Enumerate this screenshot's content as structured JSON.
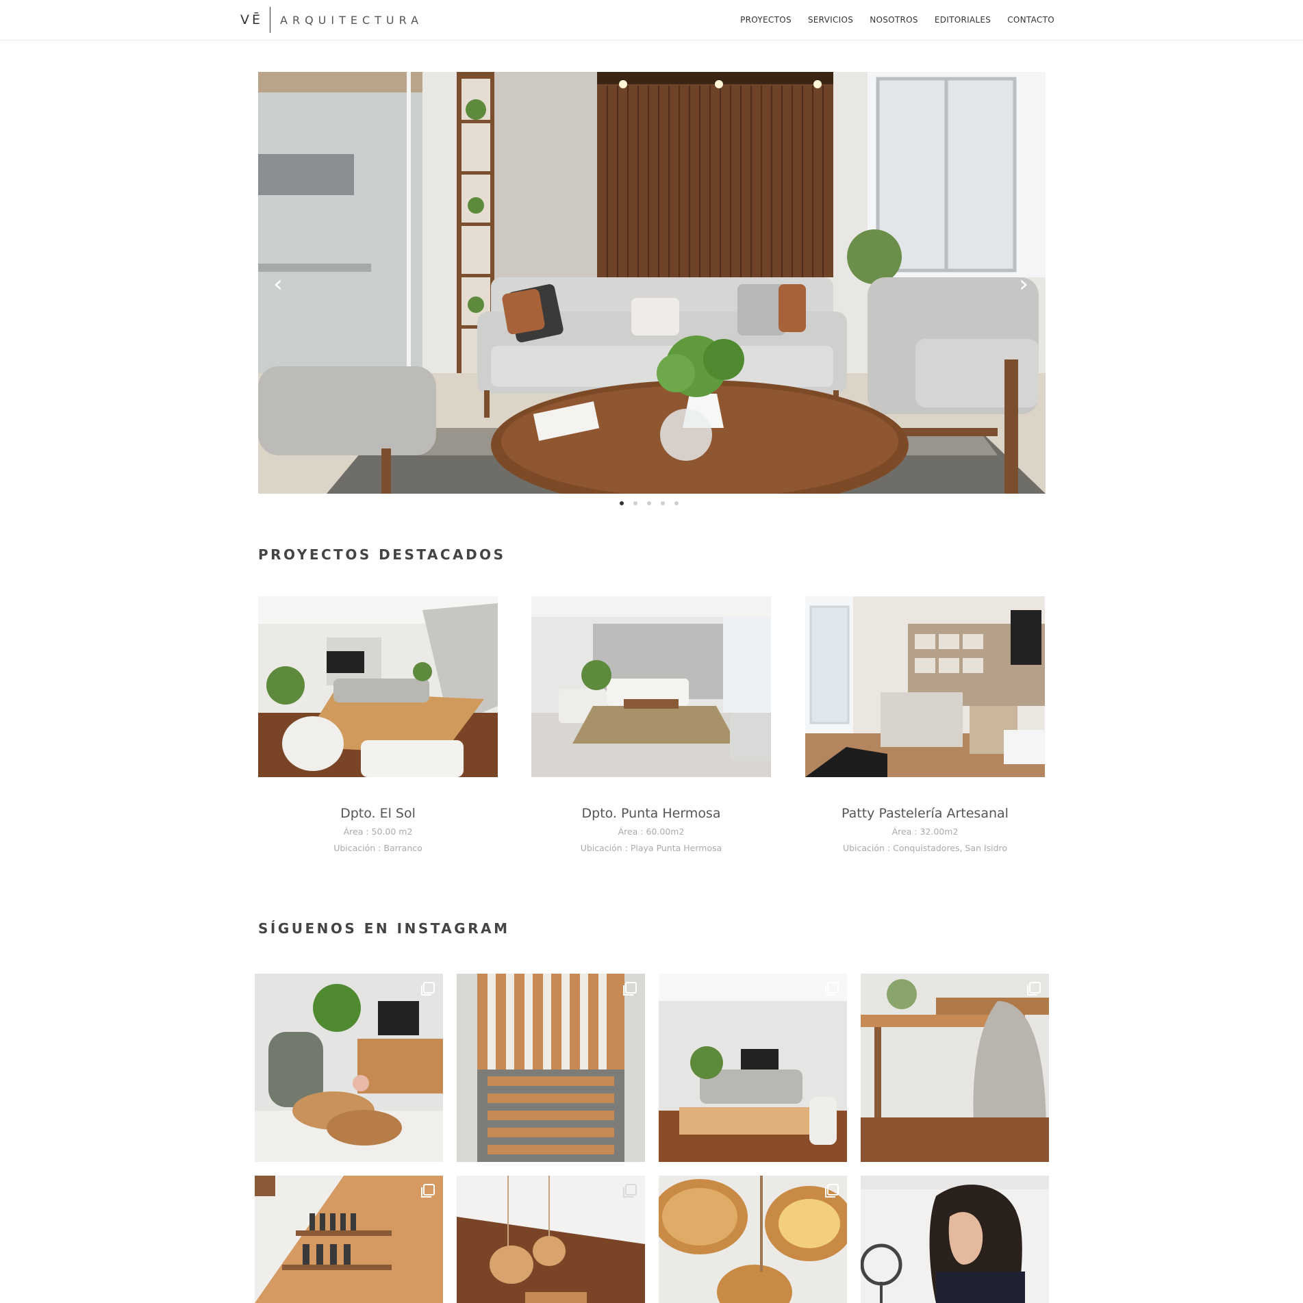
{
  "header": {
    "logo_mark": "VĒ",
    "logo_name": "ARQUITECTURA",
    "nav": [
      "PROYECTOS",
      "SERVICIOS",
      "NOSOTROS",
      "EDITORIALES",
      "CONTACTO"
    ]
  },
  "hero": {
    "prev_icon": "chevron-left-icon",
    "next_icon": "chevron-right-icon",
    "prev_glyph": "‹",
    "next_glyph": "›",
    "slide_count": 5,
    "active_slide": 1
  },
  "featured": {
    "title": "PROYECTOS DESTACADOS",
    "projects": [
      {
        "name": "Dpto. El Sol",
        "area": "Área : 50.00 m2",
        "location": "Ubicación : Barranco"
      },
      {
        "name": "Dpto. Punta Hermosa",
        "area": "Área : 60.00m2",
        "location": "Ubicación : Playa Punta Hermosa"
      },
      {
        "name": "Patty Pastelería Artesanal",
        "area": "Área : 32.00m2",
        "location": "Ubicación : Conquistadores, San Isidro"
      }
    ]
  },
  "instagram": {
    "title": "SÍGUENOS EN INSTAGRAM",
    "post_icon": "carousel-post-icon"
  },
  "colors": {
    "text": "#4a4a4a",
    "muted": "#aaaaaa",
    "wood": "#8a5a36",
    "sofa": "#d9d9d9"
  }
}
